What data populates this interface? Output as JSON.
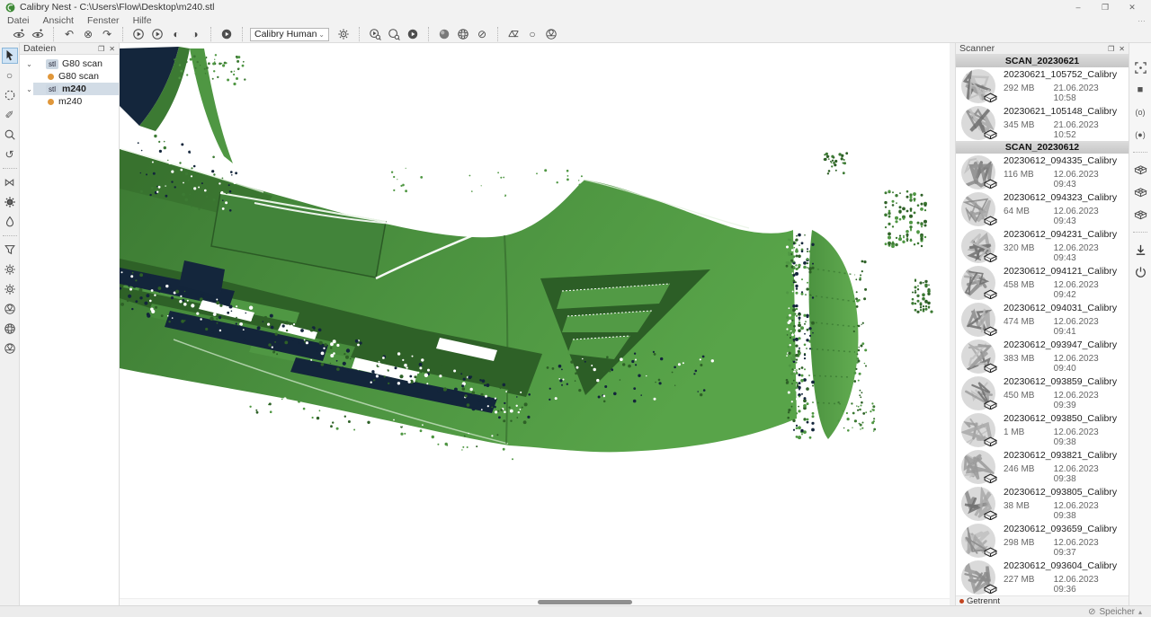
{
  "window": {
    "title": "Calibry Nest - C:\\Users\\Flow\\Desktop\\m240.stl",
    "controls": [
      {
        "name": "minimize-button",
        "glyph": "–"
      },
      {
        "name": "maximize-button",
        "glyph": "❐"
      },
      {
        "name": "close-button",
        "glyph": "✕"
      }
    ]
  },
  "menubar": [
    "Datei",
    "Ansicht",
    "Fenster",
    "Hilfe"
  ],
  "toolbar": {
    "preset_value": "Calibry Human",
    "overflow_glyph": "…",
    "groups": [
      {
        "buttons": [
          {
            "name": "import-view-icon",
            "icon": "eye-plus"
          },
          {
            "name": "import-view-alt-icon",
            "icon": "eye-plus"
          }
        ]
      },
      {
        "buttons": [
          {
            "name": "undo-icon",
            "glyph": "↶"
          },
          {
            "name": "cancel-icon",
            "glyph": "⊗"
          },
          {
            "name": "redo-icon",
            "glyph": "↷"
          }
        ]
      },
      {
        "buttons": [
          {
            "name": "play-icon",
            "icon": "play-circle"
          },
          {
            "name": "play-alt-icon",
            "icon": "play-circle"
          },
          {
            "name": "contrast-left-icon",
            "glyph": "◐"
          },
          {
            "name": "contrast-right-icon",
            "glyph": "◑"
          }
        ]
      },
      {
        "buttons": [
          {
            "name": "play-filled-icon",
            "icon": "play-filled"
          }
        ]
      },
      {
        "has_preset": true,
        "buttons": [
          {
            "name": "preset-settings-gear-icon",
            "icon": "gear"
          }
        ]
      },
      {
        "buttons": [
          {
            "name": "play-search-icon",
            "icon": "play-zoom"
          },
          {
            "name": "sphere-search-icon",
            "icon": "circle-zoom"
          },
          {
            "name": "play-filled-alt-icon",
            "icon": "play-filled"
          }
        ]
      },
      {
        "buttons": [
          {
            "name": "sphere-shaded-icon",
            "icon": "sphere"
          },
          {
            "name": "sphere-mesh-icon",
            "icon": "sphere-mesh"
          },
          {
            "name": "disabled-icon",
            "glyph": "⊘"
          }
        ]
      },
      {
        "buttons": [
          {
            "name": "mesh-wire-icon",
            "icon": "mesh"
          },
          {
            "name": "circle-outline-icon",
            "glyph": "○"
          },
          {
            "name": "mesh-ball-icon",
            "icon": "mesh-ball"
          }
        ]
      }
    ]
  },
  "left_toolbar": [
    {
      "name": "select-pointer-icon",
      "icon": "pointer",
      "selected": true
    },
    {
      "name": "lasso-circle-icon",
      "glyph": "○"
    },
    {
      "name": "lasso-dashed-icon",
      "icon": "dashed-circle"
    },
    {
      "name": "lasso-freehand-icon",
      "glyph": "✐"
    },
    {
      "name": "selection-zoom-icon",
      "icon": "magnifier"
    },
    {
      "name": "selection-rotate-icon",
      "glyph": "↺"
    },
    {
      "sep": true
    },
    {
      "name": "align-icon",
      "glyph": "⋈"
    },
    {
      "name": "registration-gear-icon",
      "icon": "gear-dark"
    },
    {
      "name": "smoothing-drop-icon",
      "icon": "drop"
    },
    {
      "sep": true
    },
    {
      "name": "filter-funnel-icon",
      "icon": "funnel"
    },
    {
      "name": "mesh-build-gear-icon",
      "icon": "gear"
    },
    {
      "name": "mesh-edit-gear-icon",
      "icon": "gear"
    },
    {
      "name": "mesh-simplify-icon",
      "icon": "mesh-ball"
    },
    {
      "name": "texture-sphere-icon",
      "icon": "sphere-mesh"
    },
    {
      "name": "sphere-tool-icon",
      "icon": "mesh-ball"
    }
  ],
  "files_panel": {
    "title": "Dateien",
    "float_glyph": "❐",
    "close_glyph": "✕",
    "rows": [
      {
        "kind": "file",
        "badge": "stl",
        "label": "G80 scan",
        "selected": false,
        "expanded": true
      },
      {
        "kind": "scan",
        "label": "G80 scan"
      },
      {
        "kind": "file",
        "badge": "stl",
        "label": "m240",
        "selected": true,
        "expanded": true
      },
      {
        "kind": "scan",
        "label": "m240"
      }
    ]
  },
  "scanner_panel": {
    "title": "Scanner",
    "float_glyph": "❐",
    "close_glyph": "✕",
    "connection_status": "Getrennt",
    "groups": [
      {
        "header": "SCAN_20230621",
        "items": [
          {
            "name": "20230621_105752_Calibry",
            "size": "292 MB",
            "date": "21.06.2023 10:58"
          },
          {
            "name": "20230621_105148_Calibry",
            "size": "345 MB",
            "date": "21.06.2023 10:52"
          }
        ]
      },
      {
        "header": "SCAN_20230612",
        "items": [
          {
            "name": "20230612_094335_Calibry",
            "size": "116 MB",
            "date": "12.06.2023 09:43"
          },
          {
            "name": "20230612_094323_Calibry",
            "size": "64 MB",
            "date": "12.06.2023 09:43"
          },
          {
            "name": "20230612_094231_Calibry",
            "size": "320 MB",
            "date": "12.06.2023 09:43"
          },
          {
            "name": "20230612_094121_Calibry",
            "size": "458 MB",
            "date": "12.06.2023 09:42"
          },
          {
            "name": "20230612_094031_Calibry",
            "size": "474 MB",
            "date": "12.06.2023 09:41"
          },
          {
            "name": "20230612_093947_Calibry",
            "size": "383 MB",
            "date": "12.06.2023 09:40"
          },
          {
            "name": "20230612_093859_Calibry",
            "size": "450 MB",
            "date": "12.06.2023 09:39"
          },
          {
            "name": "20230612_093850_Calibry",
            "size": "1 MB",
            "date": "12.06.2023 09:38"
          },
          {
            "name": "20230612_093821_Calibry",
            "size": "246 MB",
            "date": "12.06.2023 09:38"
          },
          {
            "name": "20230612_093805_Calibry",
            "size": "38 MB",
            "date": "12.06.2023 09:38"
          },
          {
            "name": "20230612_093659_Calibry",
            "size": "298 MB",
            "date": "12.06.2023 09:37"
          },
          {
            "name": "20230612_093604_Calibry",
            "size": "227 MB",
            "date": "12.06.2023 09:36"
          }
        ]
      }
    ]
  },
  "right_toolbar": [
    {
      "name": "capture-region-icon",
      "icon": "capture"
    },
    {
      "name": "stop-scan-icon",
      "glyph": "■"
    },
    {
      "name": "marker-hollow-icon",
      "glyph": "(o)",
      "small": true
    },
    {
      "name": "marker-filled-icon",
      "glyph": "(●)",
      "small": true
    },
    {
      "sep": true
    },
    {
      "name": "mesh-preview-icon",
      "icon": "grid3d"
    },
    {
      "name": "mesh-preview-2-icon",
      "icon": "grid3d"
    },
    {
      "name": "mesh-preview-3-icon",
      "icon": "grid3d"
    },
    {
      "sep": true
    },
    {
      "name": "download-scan-icon",
      "icon": "download"
    },
    {
      "name": "power-icon",
      "icon": "power"
    }
  ],
  "statusbar": {
    "storage_icon_glyph": "⊘",
    "storage_label": "Speicher",
    "expand_glyph": "▴"
  },
  "colors": {
    "mesh_green": "#4a8f3e",
    "mesh_green_dark": "#2e6127",
    "mesh_green_light": "#5aa44c",
    "mesh_navy": "#14263c",
    "selection_blue": "#cfe3f5",
    "status_dot_red": "#c3441f",
    "badge_orange": "#e0973a"
  }
}
